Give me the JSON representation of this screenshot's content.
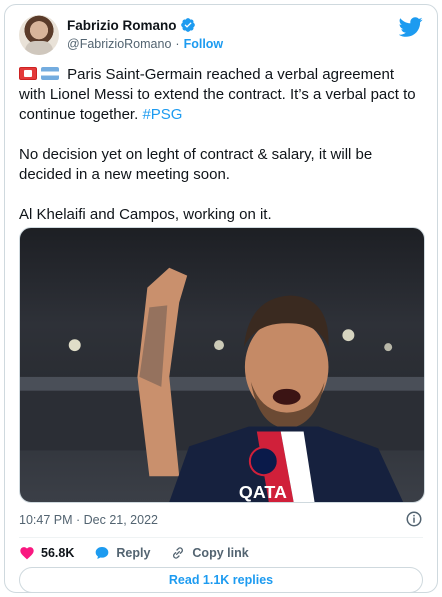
{
  "author": {
    "name": "Fabrizio Romano",
    "handle": "@FabrizioRomano",
    "separator": "·",
    "follow_label": "Follow"
  },
  "tweet": {
    "paragraph_1": "Paris Saint-Germain reached a verbal agreement with Lionel Messi to extend the contract. It’s a verbal pact to continue together.",
    "hashtag": "#PSG",
    "paragraph_2": "No decision yet on leght of contract & salary, it will be decided in a new meeting soon.",
    "paragraph_3": "Al Khelaifi and Campos, working on it.",
    "flags": [
      "flag-monaco-icon",
      "flag-argentina-icon"
    ]
  },
  "meta": {
    "timestamp": "10:47 PM · Dec 21, 2022"
  },
  "actions": {
    "likes": "56.8K",
    "reply_label": "Reply",
    "copy_link_label": "Copy link"
  },
  "replies_button": "Read 1.1K replies",
  "colors": {
    "accent": "#1d9bf0",
    "like": "#f91880",
    "text": "#0f1419",
    "muted": "#536471"
  }
}
